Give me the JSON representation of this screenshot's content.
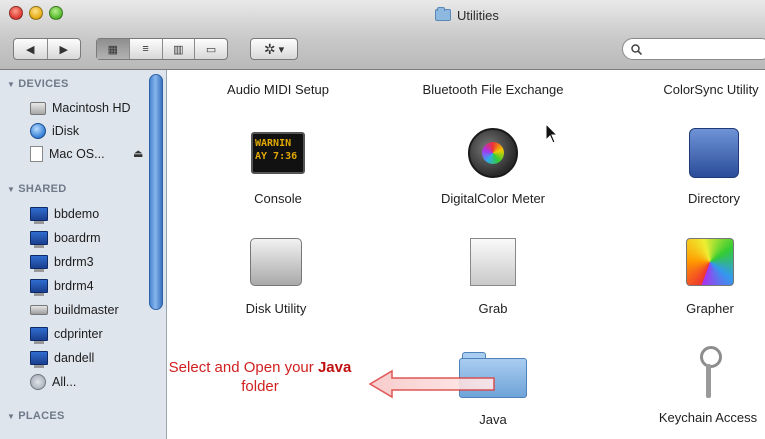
{
  "window": {
    "title": "Utilities"
  },
  "toolbar": {
    "back_label": "◀",
    "forward_label": "▶",
    "view_icon_label": "▦",
    "view_list_label": "≡",
    "view_column_label": "▥",
    "view_coverflow_label": "▭",
    "action_label": "✲",
    "action_arrow": "▾",
    "search_placeholder": ""
  },
  "sidebar": {
    "devices_header": "DEVICES",
    "devices": [
      {
        "label": "Macintosh HD",
        "icon": "hard-drive-icon"
      },
      {
        "label": "iDisk",
        "icon": "idisk-icon"
      },
      {
        "label": "Mac OS...",
        "icon": "disk-image-icon",
        "eject": "⏏"
      }
    ],
    "shared_header": "SHARED",
    "shared": [
      {
        "label": "bbdemo",
        "icon": "computer-icon"
      },
      {
        "label": "boardrm",
        "icon": "computer-icon"
      },
      {
        "label": "brdrm3",
        "icon": "computer-icon"
      },
      {
        "label": "brdrm4",
        "icon": "computer-icon"
      },
      {
        "label": "buildmaster",
        "icon": "server-icon"
      },
      {
        "label": "cdprinter",
        "icon": "computer-icon"
      },
      {
        "label": "dandell",
        "icon": "computer-icon"
      },
      {
        "label": "All...",
        "icon": "network-icon"
      }
    ],
    "places_header": "PLACES"
  },
  "content": {
    "items": [
      {
        "label": "Audio MIDI Setup"
      },
      {
        "label": "Bluetooth File Exchange"
      },
      {
        "label": "ColorSync Utility"
      },
      {
        "label": "Console",
        "icon_text_1": "WARNIN",
        "icon_text_2": "AY 7:36"
      },
      {
        "label": "DigitalColor Meter"
      },
      {
        "label": "Directory"
      },
      {
        "label": "Disk Utility"
      },
      {
        "label": "Grab"
      },
      {
        "label": "Grapher"
      },
      {
        "label": "Java"
      },
      {
        "label": "Keychain Access"
      }
    ]
  },
  "annotation": {
    "prefix": "Select and Open your ",
    "bold": "Java",
    "suffix": "folder"
  },
  "colors": {
    "annotation_red": "#d12020",
    "sidebar_bg": "#dfe5ed",
    "scrollbar_blue": "#4a86d0"
  }
}
